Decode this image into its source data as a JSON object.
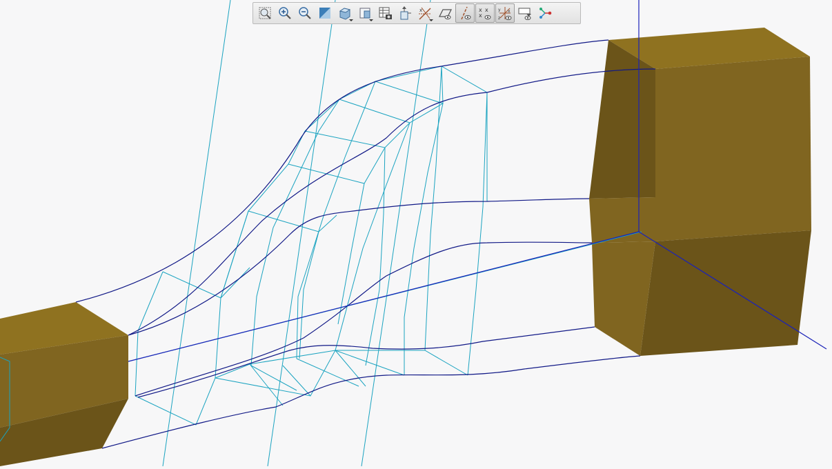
{
  "colors": {
    "background": "#f7f7f8",
    "solid_top": "#8f7220",
    "solid_front": "#806520",
    "solid_side": "#6b5419",
    "surface_mesh": "#1aa3c0",
    "curves": "#101886",
    "axis": "#1a22b8"
  },
  "toolbar": {
    "buttons": [
      {
        "icon": "refit-icon",
        "state": "normal",
        "dropdown": false
      },
      {
        "icon": "zoom-in-icon",
        "state": "normal",
        "dropdown": false
      },
      {
        "icon": "zoom-out-icon",
        "state": "normal",
        "dropdown": false
      },
      {
        "icon": "repaint-icon",
        "state": "normal",
        "dropdown": false
      },
      {
        "icon": "display-style-icon",
        "state": "normal",
        "dropdown": true
      },
      {
        "icon": "saved-orientations-icon",
        "state": "normal",
        "dropdown": true
      },
      {
        "icon": "view-manager-icon",
        "state": "normal",
        "dropdown": false
      },
      {
        "icon": "perspective-view-icon",
        "state": "normal",
        "dropdown": false
      },
      {
        "icon": "datum-display-filters-icon",
        "state": "normal",
        "dropdown": true
      },
      {
        "icon": "plane-display-icon",
        "state": "normal",
        "dropdown": false
      },
      {
        "icon": "axis-display-icon",
        "state": "active",
        "dropdown": false
      },
      {
        "icon": "point-display-icon",
        "state": "active",
        "dropdown": false
      },
      {
        "icon": "csys-display-icon",
        "state": "active",
        "dropdown": false
      },
      {
        "icon": "annotation-display-icon",
        "state": "normal",
        "dropdown": false
      },
      {
        "icon": "spin-center-icon",
        "state": "normal",
        "dropdown": false
      }
    ]
  }
}
